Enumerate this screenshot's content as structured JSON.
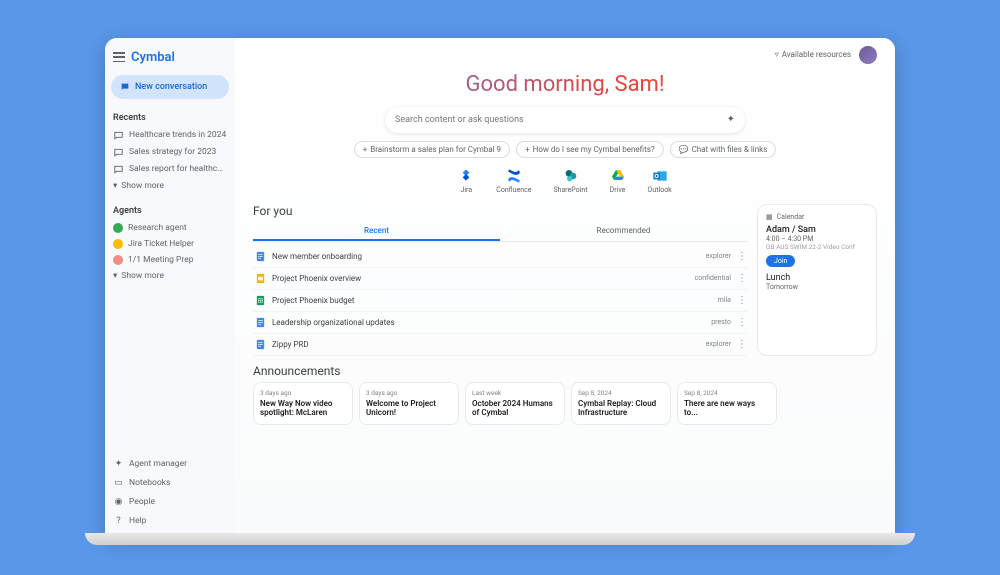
{
  "brand": "Cymbal",
  "new_conv": "New conversation",
  "sidebar": {
    "recents_header": "Recents",
    "recents": [
      {
        "label": "Healthcare trends in 2024"
      },
      {
        "label": "Sales strategy for 2023"
      },
      {
        "label": "Sales report for healthcare"
      }
    ],
    "show_more": "Show more",
    "agents_header": "Agents",
    "agents": [
      {
        "label": "Research agent",
        "color": "#34a853"
      },
      {
        "label": "Jira Ticket Helper",
        "color": "#fbbc04"
      },
      {
        "label": "1/1 Meeting Prep",
        "color": "#f28b82"
      }
    ],
    "bottom": [
      {
        "label": "Agent manager",
        "icon": "sparkle"
      },
      {
        "label": "Notebooks",
        "icon": "notebook"
      },
      {
        "label": "People",
        "icon": "person"
      },
      {
        "label": "Help",
        "icon": "help"
      }
    ]
  },
  "topbar": {
    "available": "Available resources"
  },
  "greeting": "Good morning, Sam!",
  "search": {
    "placeholder": "Search content or ask questions"
  },
  "chips": [
    {
      "label": "Brainstorm a sales plan for Cymbal 9",
      "icon": "plus"
    },
    {
      "label": "How do I see my Cymbal benefits?",
      "icon": "plus"
    },
    {
      "label": "Chat with files & links",
      "icon": "chat"
    }
  ],
  "apps": [
    {
      "label": "Jira",
      "icon": "jira"
    },
    {
      "label": "Confluence",
      "icon": "confluence"
    },
    {
      "label": "SharePoint",
      "icon": "sharepoint"
    },
    {
      "label": "Drive",
      "icon": "drive"
    },
    {
      "label": "Outlook",
      "icon": "outlook"
    }
  ],
  "for_you": {
    "title": "For you",
    "tabs": [
      "Recent",
      "Recommended"
    ],
    "docs": [
      {
        "name": "New member onboarding",
        "meta": "explorer",
        "type": "doc"
      },
      {
        "name": "Project Phoenix overview",
        "meta": "confidential",
        "type": "slides"
      },
      {
        "name": "Project Phoenix budget",
        "meta": "mila",
        "type": "sheets"
      },
      {
        "name": "Leadership organizational updates",
        "meta": "presto",
        "type": "doc"
      },
      {
        "name": "Zippy PRD",
        "meta": "explorer",
        "type": "doc"
      }
    ]
  },
  "calendar": {
    "header": "Calendar",
    "event1_title": "Adam / Sam",
    "event1_time": "4:00 – 4:30 PM",
    "event1_detail": "GB AUS SWIM 22-2 Video Conf",
    "join": "Join",
    "event2_title": "Lunch",
    "event2_time": "Tomorrow"
  },
  "announcements": {
    "title": "Announcements",
    "cards": [
      {
        "date": "3 days ago",
        "title": "New Way Now video spotlight: McLaren"
      },
      {
        "date": "3 days ago",
        "title": "Welcome to Project Unicorn!"
      },
      {
        "date": "Last week",
        "title": "October 2024 Humans of Cymbal"
      },
      {
        "date": "Sep 8, 2024",
        "title": "Cymbal Replay: Cloud Infrastructure"
      },
      {
        "date": "Sep 8, 2024",
        "title": "There are new ways to..."
      }
    ]
  }
}
